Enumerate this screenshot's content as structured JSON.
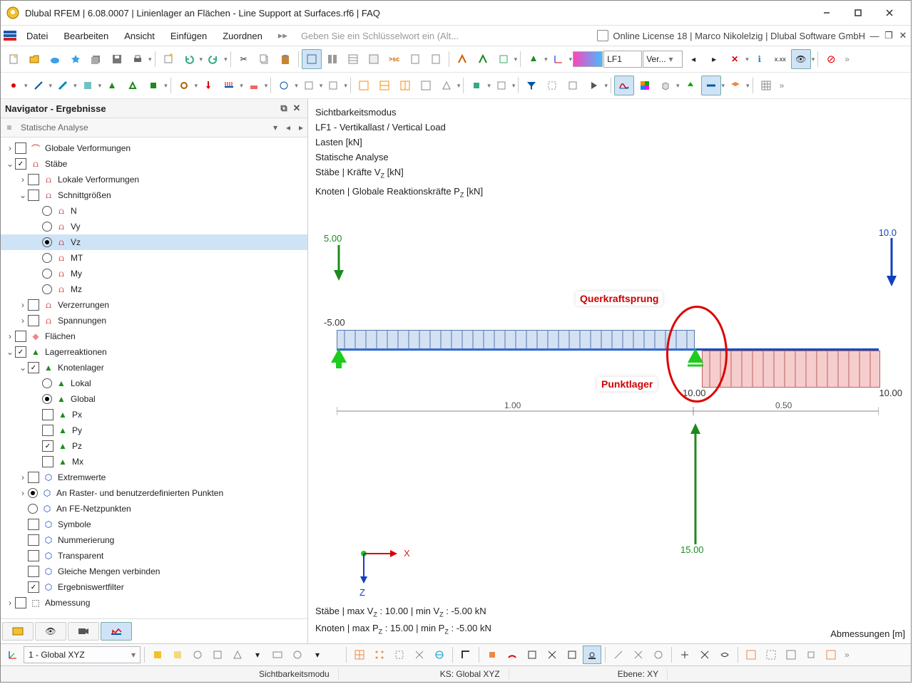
{
  "titlebar": {
    "title": "Dlubal RFEM | 6.08.0007 | Linienlager an Flächen - Line Support at Surfaces.rf6 | FAQ"
  },
  "menu": {
    "items": [
      "Datei",
      "Bearbeiten",
      "Ansicht",
      "Einfügen",
      "Zuordnen"
    ],
    "search_placeholder": "Geben Sie ein Schlüsselwort ein (Alt...",
    "license": "Online License 18 | Marco Nikolelzig | Dlubal Software GmbH"
  },
  "toolbar_top": {
    "lf_label": "LF1",
    "lf_text": "Ver..."
  },
  "navigator": {
    "title": "Navigator - Ergebnisse",
    "analysis": "Statische Analyse",
    "tree": {
      "globale_verformungen": "Globale Verformungen",
      "stabe": "Stäbe",
      "lokale_verformungen": "Lokale Verformungen",
      "schnittgrossen": "Schnittgrößen",
      "n": "N",
      "vy": "Vy",
      "vz": "Vz",
      "mt": "MT",
      "my": "My",
      "mz": "Mz",
      "verzerrungen": "Verzerrungen",
      "spannungen": "Spannungen",
      "flachen": "Flächen",
      "lagerreaktionen": "Lagerreaktionen",
      "knotenlager": "Knotenlager",
      "lokal": "Lokal",
      "global": "Global",
      "px": "Px",
      "py": "Py",
      "pz": "Pz",
      "mx": "Mx",
      "extremwerte": "Extremwerte",
      "raster": "An Raster- und benutzerdefinierten Punkten",
      "fe": "An FE-Netzpunkten",
      "symbole": "Symbole",
      "nummerierung": "Nummerierung",
      "transparent": "Transparent",
      "gleiche": "Gleiche Mengen verbinden",
      "filter": "Ergebniswertfilter",
      "abmessung": "Abmessung"
    }
  },
  "view": {
    "info": {
      "l1": "Sichtbarkeitsmodus",
      "l2": "LF1 - Vertikallast / Vertical Load",
      "l3": "Lasten [kN]",
      "l4": "Statische Analyse",
      "l5": "Stäbe | Kräfte Vz [kN]",
      "l6": "Knoten | Globale Reaktionskräfte Pz [kN]"
    },
    "annotations": {
      "querkraft": "Querkraftsprung",
      "punktlager": "Punktlager"
    },
    "values": {
      "load1": "5.00",
      "load2": "10.0",
      "vz_left": "-5.00",
      "vz_right": "10.00",
      "dim1": "1.00",
      "dim2": "0.50",
      "reaction": "15.00",
      "axis_x": "X",
      "axis_z": "Z",
      "support_val": "10.00"
    },
    "bottom": {
      "l1": "Stäbe | max Vz : 10.00 | min Vz : -5.00 kN",
      "l2": "Knoten | max Pz : 15.00 | min Pz : -5.00 kN"
    },
    "right_label": "Abmessungen [m]"
  },
  "status2": {
    "cs": "1 - Global XYZ"
  },
  "statusbar": {
    "c1": "Sichtbarkeitsmodu",
    "c2": "KS: Global XYZ",
    "c3": "Ebene: XY"
  }
}
